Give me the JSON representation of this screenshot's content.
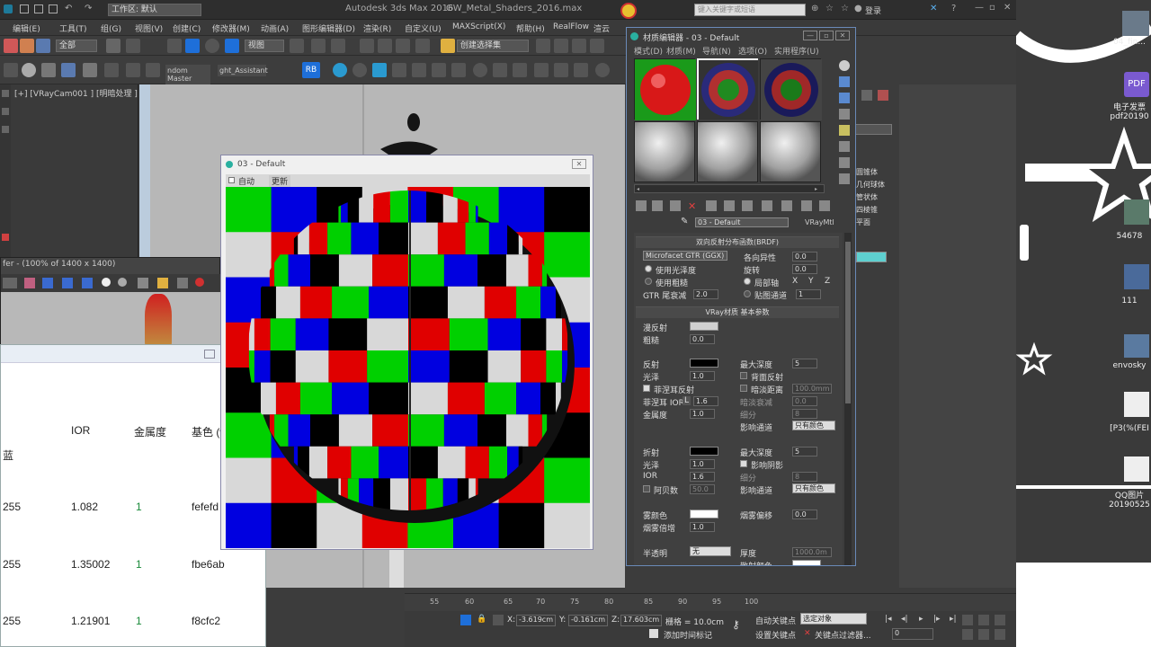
{
  "app": {
    "title": "Autodesk 3ds Max 2016",
    "file": "GW_Metal_Shaders_2016.max",
    "workspace": "工作区: 默认",
    "search_placeholder": "键入关键字或短语",
    "login": "登录"
  },
  "menu": [
    "编辑(E)",
    "工具(T)",
    "组(G)",
    "视图(V)",
    "创建(C)",
    "修改器(M)",
    "动画(A)",
    "图形编辑器(D)",
    "渲染(R)",
    "自定义(U)",
    "MAXScript(X)",
    "帮助(H)",
    "RealFlow",
    "渲云"
  ],
  "toolbar": {
    "selection_filter": "全部",
    "view_dropdown": "视图",
    "named_selection": "创建选择集",
    "tab_random_master": "ndom Master",
    "tab_light_assistant": "ght_Assistant",
    "rb_label": "RB"
  },
  "viewport": {
    "label": "[+] [VRayCam001 ] [明暗处理 ]"
  },
  "frame_buffer": {
    "title": "fer - (100% of 1400 x 1400)"
  },
  "ior_table": {
    "headers": [
      "IOR",
      "金属度",
      "基色 (web)"
    ],
    "row_label": "蓝",
    "rows": [
      {
        "blue": "255",
        "ior": "1.082",
        "metal": "1",
        "web": "fefefd"
      },
      {
        "blue": "255",
        "ior": "1.35002",
        "metal": "1",
        "web": "fbe6ab"
      },
      {
        "blue": "255",
        "ior": "1.21901",
        "metal": "1",
        "web": "f8cfc2"
      }
    ]
  },
  "render_window": {
    "title": "03 - Default",
    "auto_label": "自动",
    "update_label": "更新"
  },
  "material_editor": {
    "title": "材质编辑器 - 03 - Default",
    "menu": [
      "模式(D)",
      "材质(M)",
      "导航(N)",
      "选项(O)",
      "实用程序(U)"
    ],
    "material_name": "03 - Default",
    "material_type": "VRayMtl",
    "brdf": {
      "rollout": "双向反射分布函数(BRDF)",
      "type": "Microfacet GTR (GGX)",
      "use_glossiness": "使用光泽度",
      "use_roughness": "使用粗糙",
      "gtr_tail": "GTR 尾衰减",
      "gtr_tail_value": "2.0",
      "anisotropy": "各向异性",
      "anisotropy_value": "0.0",
      "rotation": "旋转",
      "rotation_value": "0.0",
      "local_axis": "局部轴",
      "map_channel": "贴图通道",
      "map_channel_value": "1",
      "axis_x": "X",
      "axis_y": "Y",
      "axis_z": "Z"
    },
    "basic": {
      "rollout": "VRay材质 基本参数",
      "diffuse": "漫反射",
      "roughness": "粗糙",
      "roughness_value": "0.0",
      "reflect": "反射",
      "gloss": "光泽",
      "gloss_value": "1.0",
      "fresnel": "菲涅耳反射",
      "fresnel_ior": "菲涅耳 IOR",
      "fresnel_ior_lock": "L",
      "fresnel_ior_value": "1.6",
      "metalness": "金属度",
      "metalness_value": "1.0",
      "max_depth": "最大深度",
      "max_depth_value": "5",
      "back_reflect": "背面反射",
      "dim_distance": "暗淡距离",
      "dim_distance_value": "100.0mm",
      "dim_falloff": "暗淡衰减",
      "dim_falloff_value": "0.0",
      "subdivs": "细分",
      "subdivs_value": "8",
      "affect_channels": "影响通道",
      "affect_channels_value": "只有颜色",
      "refract": "折射",
      "refract_gloss": "光泽",
      "refract_gloss_value": "1.0",
      "ior": "IOR",
      "ior_value": "1.6",
      "abbe": "阿贝数",
      "abbe_value": "50.0",
      "refract_max_depth": "最大深度",
      "refract_max_depth_value": "5",
      "affect_shadows": "影响阴影",
      "refract_subdivs": "细分",
      "refract_subdivs_value": "8",
      "refract_affect_channels": "影响通道",
      "refract_affect_channels_value": "只有颜色",
      "fog_color": "雾颜色",
      "fog_multiplier": "烟雾倍增",
      "fog_multiplier_value": "1.0",
      "fog_bias": "烟雾偏移",
      "fog_bias_value": "0.0",
      "translucency": "半透明",
      "translucency_value": "无",
      "thickness": "厚度",
      "thickness_value": "1000.0m",
      "scatter_color": "散射颜色"
    }
  },
  "side_panel": {
    "items": [
      "圆锥体",
      "几何球体",
      "管状体",
      "四棱锥",
      "平面"
    ]
  },
  "timeline": {
    "ticks": [
      "55",
      "60",
      "65",
      "70",
      "75",
      "80",
      "85",
      "90",
      "95",
      "100"
    ]
  },
  "status": {
    "x_label": "X:",
    "x": "-3.619cm",
    "y_label": "Y:",
    "y": "-0.161cm",
    "z_label": "Z:",
    "z": "17.603cm",
    "grid": "栅格 = 10.0cm",
    "add_time_tag": "添加时间标记",
    "auto_key": "自动关键点",
    "selected_object": "选定对象",
    "set_key": "设置关键点",
    "key_filter": "关键点过滤器...",
    "frame": "0"
  },
  "desktop": {
    "icons": [
      "04_fin...",
      "电子发票 pdf20190",
      "54678",
      "111",
      "envosky",
      "[P3(%(FEI",
      "QQ图片 20190525"
    ]
  },
  "colors": {
    "checker_red": "#e00000",
    "checker_green": "#00d000",
    "checker_blue": "#0000e0",
    "checker_black": "#000000",
    "checker_light": "#d8d8d8",
    "accent_blue": "#1e6fd9"
  }
}
